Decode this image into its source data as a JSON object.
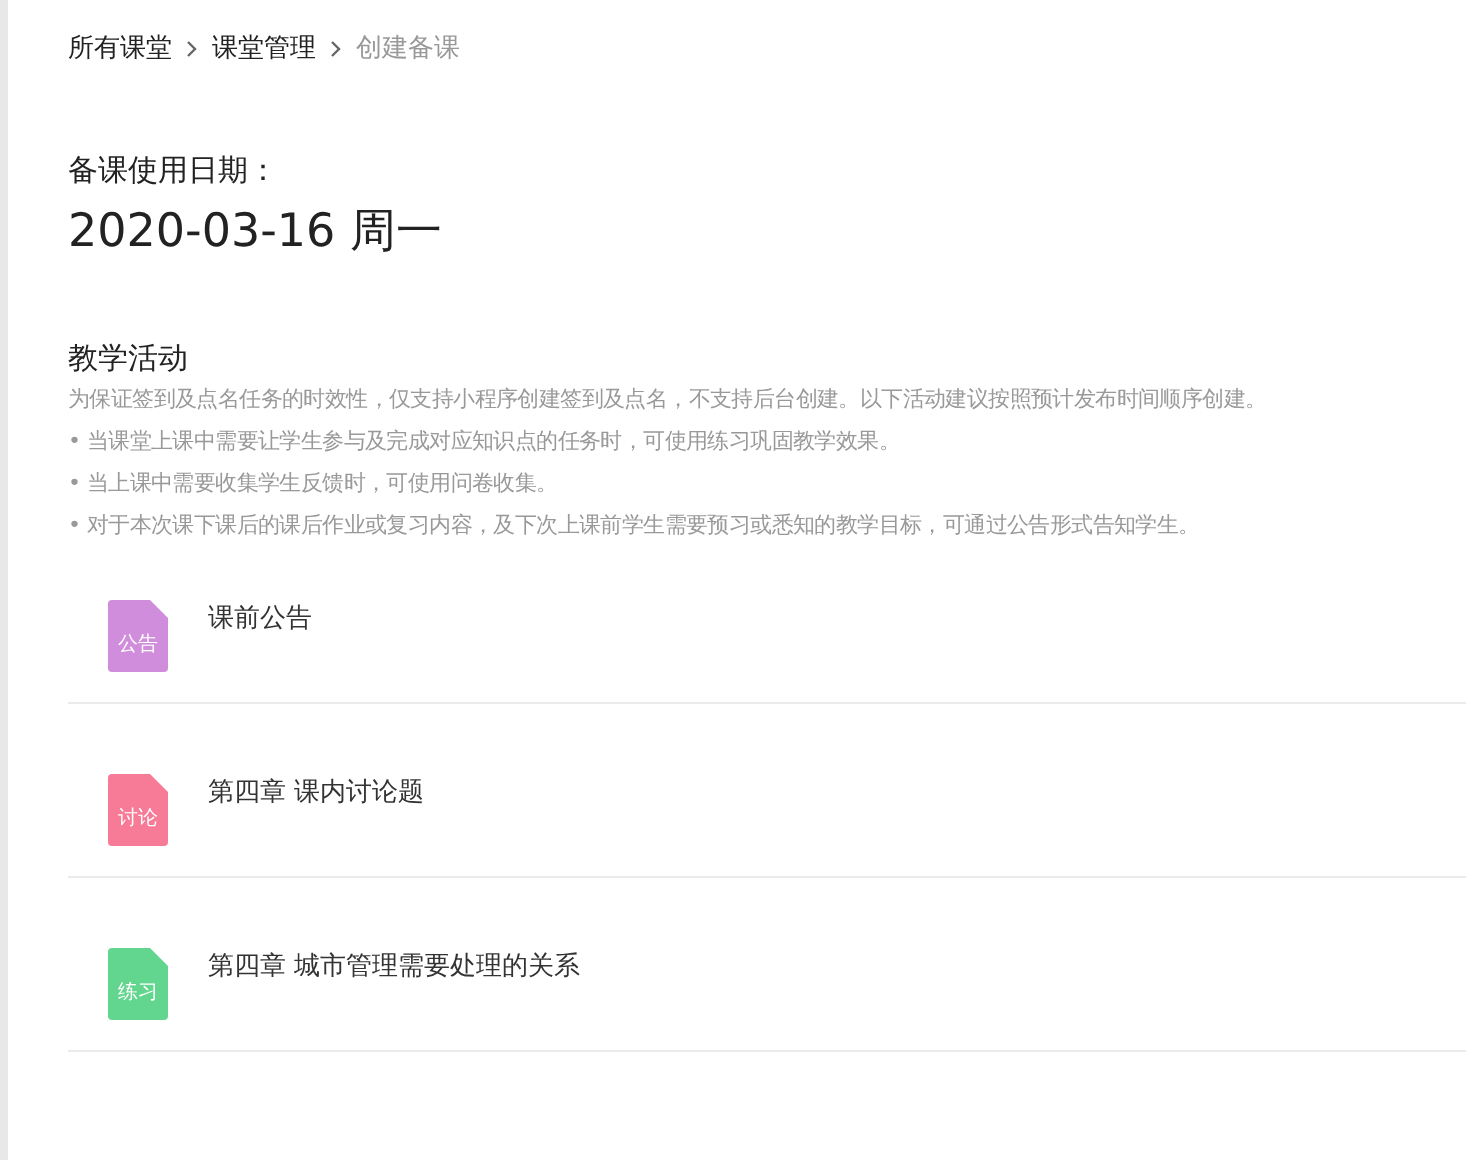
{
  "breadcrumb": [
    {
      "label": "所有课堂",
      "current": false
    },
    {
      "label": "课堂管理",
      "current": false
    },
    {
      "label": "创建备课",
      "current": true
    }
  ],
  "date_label": "备课使用日期：",
  "date": "2020-03-16 周一",
  "section": {
    "title": "教学活动",
    "description": "为保证签到及点名任务的时效性，仅支持小程序创建签到及点名，不支持后台创建。以下活动建议按照预计发布时间顺序创建。",
    "tips": [
      "• 当课堂上课中需要让学生参与及完成对应知识点的任务时，可使用练习巩固教学效果。",
      "• 当上课中需要收集学生反馈时，可使用问卷收集。",
      "• 对于本次课下课后的课后作业或复习内容，及下次上课前学生需要预习或悉知的教学目标，可通过公告形式告知学生。"
    ]
  },
  "activities": [
    {
      "tag": "公告",
      "color": "#d08ddc",
      "title": "课前公告"
    },
    {
      "tag": "讨论",
      "color": "#f77a96",
      "title": "第四章 课内讨论题"
    },
    {
      "tag": "练习",
      "color": "#62d68e",
      "title": "第四章 城市管理需要处理的关系"
    }
  ]
}
